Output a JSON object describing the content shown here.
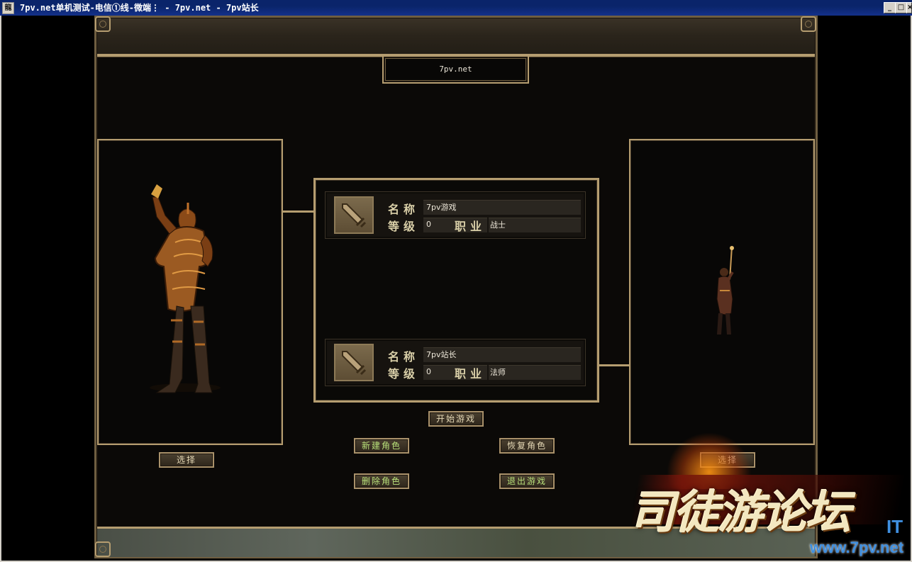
{
  "window": {
    "title": "7pv.net单机测试-电信①线-微端⋮ - 7pv.net - 7pv站长",
    "icon_char": "龍",
    "minimize": "_",
    "maximize": "□",
    "close": "×"
  },
  "server": {
    "name": "7pv.net"
  },
  "characters": [
    {
      "name_label": "名称",
      "name": "7pv游戏",
      "level_label": "等级",
      "level": "0",
      "class_label": "职业",
      "class": "战士"
    },
    {
      "name_label": "名称",
      "name": "7pv站长",
      "level_label": "等级",
      "level": "0",
      "class_label": "职业",
      "class": "法师"
    }
  ],
  "buttons": {
    "start_game": "开始游戏",
    "new_char": "新建角色",
    "restore_char": "恢复角色",
    "delete_char": "删除角色",
    "exit_game": "退出游戏",
    "select_left": "选择",
    "select_right": "选择"
  },
  "watermark": {
    "text": "司徒游论坛",
    "url": "www.7pv.net",
    "cap": "IT"
  },
  "colors": {
    "frame_gold": "#b59d70",
    "panel_bg": "#0b0907",
    "button_text": "#e6d9b6",
    "button_text_green": "#b8e07a"
  }
}
